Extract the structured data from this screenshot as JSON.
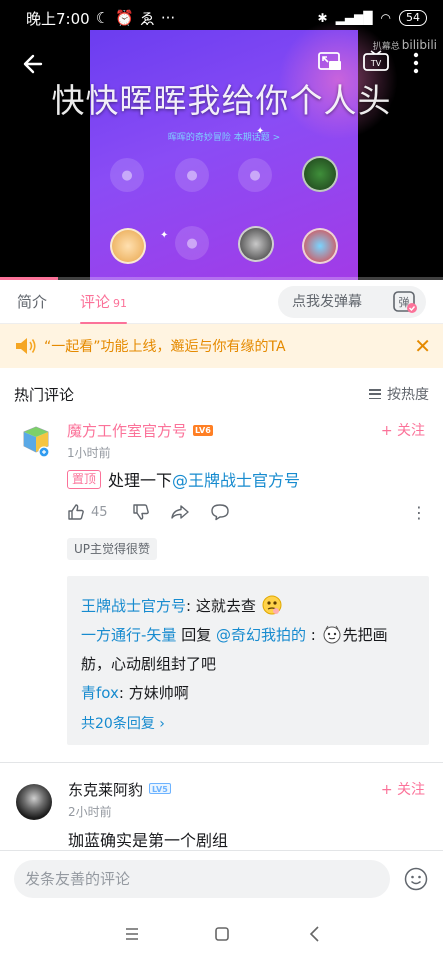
{
  "status_bar": {
    "time": "晚上7:00",
    "icons": [
      "moon-icon",
      "alarm-icon",
      "app-icon",
      "more-dots-icon",
      "bluetooth-icon",
      "signal-icon",
      "wifi-icon"
    ],
    "battery": "54"
  },
  "player": {
    "danmaku_overlay": "快快晖晖我给你个人头",
    "watermark_prefix": "扒幕总",
    "watermark_brand": "bilibili",
    "room_subtitle": "晖晖的奇妙冒险",
    "room_subtitle_link": "本期话题 >",
    "progress": 0.13,
    "accent_color": "#fb7299"
  },
  "tabs": {
    "intro": "简介",
    "comments": "评论",
    "comments_count": "91",
    "danmaku_placeholder": "点我发弹幕",
    "danmaku_toggle": "弹"
  },
  "notice": {
    "text": "“一起看”功能上线，邂逅与你有缘的TA"
  },
  "hot_comments": {
    "title": "热门评论",
    "sort_label": "按热度"
  },
  "comment1": {
    "username": "魔方工作室官方号",
    "level": "LV6",
    "follow_label": "+ 关注",
    "time": "1小时前",
    "pin_label": "置顶",
    "text": "处理一下",
    "mention": "@王牌战士官方号",
    "likes": "45",
    "up_liked": "UP主觉得很赞",
    "replies": [
      {
        "name": "王牌战士官方号",
        "text": ": 这就去查"
      },
      {
        "name": "一方通行-矢量",
        "reply_word": " 回复 ",
        "target": "@奇幻我拍的",
        "text": " :",
        "text2": "先把画舫，心动剧组封了吧"
      },
      {
        "name": "青fox",
        "text": ": 方妹帅啊"
      }
    ],
    "more_replies": "共20条回复"
  },
  "comment2": {
    "username": "东克莱阿豹",
    "level": "LV5",
    "follow_label": "+ 关注",
    "time": "2小时前",
    "text": "珈蓝确实是第一个剧组"
  },
  "composer": {
    "placeholder": "发条友善的评论"
  }
}
